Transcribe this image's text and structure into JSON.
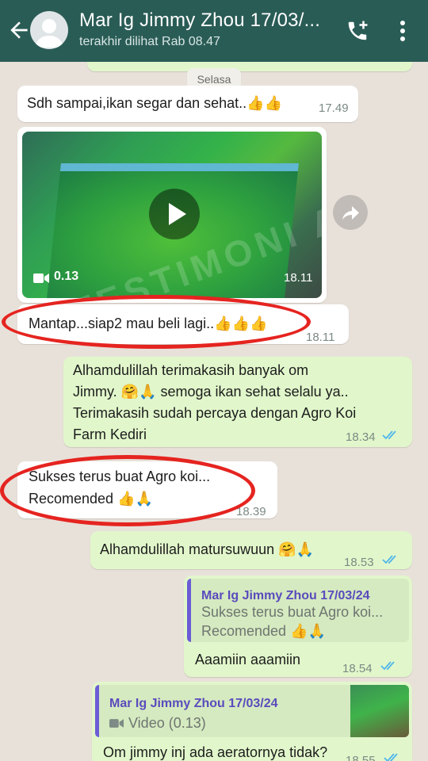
{
  "header": {
    "title": "Mar Ig Jimmy Zhou 17/03/...",
    "subtitle": "terakhir dilihat Rab 08.47",
    "icons": [
      "back-arrow-icon",
      "avatar",
      "add-call-icon",
      "more-menu-icon"
    ]
  },
  "chat": {
    "day_label": "Selasa",
    "messages": [
      {
        "dir": "in",
        "text": "Sdh sampai,ikan segar dan sehat..👍👍",
        "time": "17.49"
      },
      {
        "dir": "in",
        "type": "video",
        "duration": "0.13",
        "time": "18.11",
        "watermark": "TESTIMONI AGRO KOI FARM"
      },
      {
        "dir": "in",
        "text": "Mantap...siap2 mau beli lagi..👍👍👍",
        "time": "18.11"
      },
      {
        "dir": "out",
        "lines": [
          "Alhamdulillah terimakasih banyak om",
          "Jimmy. 🤗🙏 semoga ikan sehat selalu ya..",
          "Terimakasih sudah percaya dengan Agro Koi",
          "Farm Kediri"
        ],
        "time": "18.34"
      },
      {
        "dir": "in",
        "lines": [
          "Sukses terus buat Agro koi...",
          "Recomended 👍🙏"
        ],
        "time": "18.39"
      },
      {
        "dir": "out",
        "text": "Alhamdulillah matursuwuun 🤗🙏",
        "time": "18.53"
      },
      {
        "dir": "out",
        "reply": {
          "name": "Mar Ig Jimmy Zhou 17/03/24",
          "lines": [
            "Sukses terus buat Agro koi...",
            "Recomended 👍🙏"
          ]
        },
        "text": "Aaamiin aaamiin",
        "time": "18.54"
      },
      {
        "dir": "out",
        "reply": {
          "name": "Mar Ig Jimmy Zhou 17/03/24",
          "text": "Video (0.13)"
        },
        "text": "Om jimmy inj ada aeratornya tidak?",
        "time": "18.55"
      }
    ]
  },
  "colors": {
    "header_bg": "#2a5c56",
    "incoming_bubble": "#ffffff",
    "outgoing_bubble": "#e1f7cb",
    "read_ticks": "#4fb6ec",
    "highlight_ring": "#e52420",
    "quote_accent": "#6b5bd6"
  }
}
